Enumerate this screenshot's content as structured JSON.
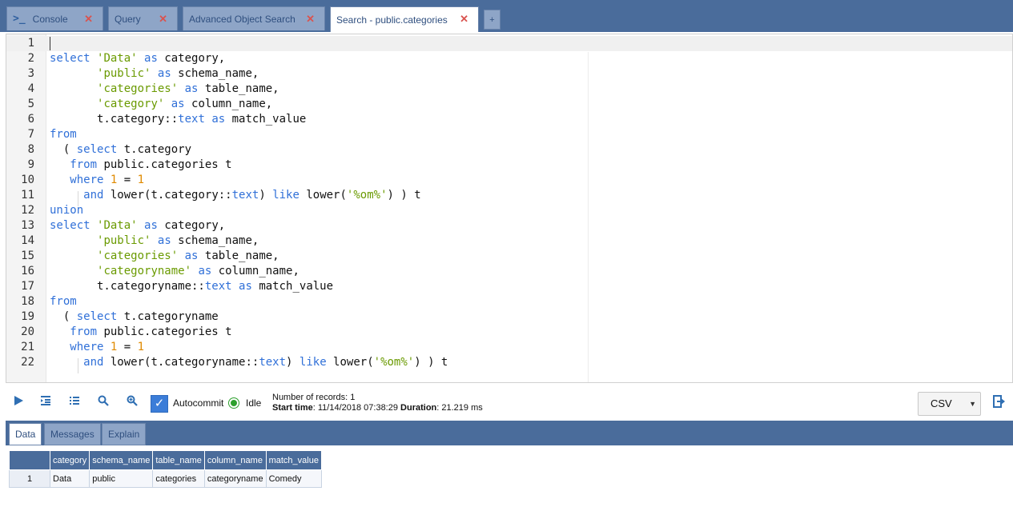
{
  "tabs": [
    {
      "label": "Console",
      "icon": "terminal-icon",
      "active": false
    },
    {
      "label": "Query",
      "active": false
    },
    {
      "label": "Advanced Object Search",
      "active": false
    },
    {
      "label": "Search - public.categories",
      "active": true
    }
  ],
  "tab_add_label": "+",
  "editor": {
    "lines": [
      "",
      "select 'Data' as category,",
      "       'public' as schema_name,",
      "       'categories' as table_name,",
      "       'category' as column_name,",
      "       t.category::text as match_value",
      "from",
      "  ( select t.category",
      "   from public.categories t",
      "   where 1 = 1",
      "     and lower(t.category::text) like lower('%om%') ) t",
      "union",
      "select 'Data' as category,",
      "       'public' as schema_name,",
      "       'categories' as table_name,",
      "       'categoryname' as column_name,",
      "       t.categoryname::text as match_value",
      "from",
      "  ( select t.categoryname",
      "   from public.categories t",
      "   where 1 = 1",
      "     and lower(t.categoryname::text) like lower('%om%') ) t"
    ]
  },
  "toolbar": {
    "autocommit_label": "Autocommit",
    "autocommit_checked": true,
    "status": "Idle",
    "records_label": "Number of records:",
    "records_value": "1",
    "start_label": "Start time",
    "start_value": ": 11/14/2018 07:38:29",
    "duration_label": "Duration",
    "duration_value": ": 21.219 ms",
    "export_format": "CSV"
  },
  "result_tabs": [
    {
      "label": "Data",
      "active": true
    },
    {
      "label": "Messages",
      "active": false
    },
    {
      "label": "Explain",
      "active": false
    }
  ],
  "grid": {
    "columns": [
      "",
      "category",
      "schema_name",
      "table_name",
      "column_name",
      "match_value"
    ],
    "rows": [
      [
        "1",
        "Data",
        "public",
        "categories",
        "categoryname",
        "Comedy"
      ]
    ]
  },
  "colors": {
    "header_blue": "#4a6c9b",
    "tab_inactive": "#8ea5c7",
    "keyword": "#3070d8",
    "string": "#6a9a00",
    "number": "#e08a00",
    "close": "#d9534f",
    "status_idle": "#2ca02c"
  }
}
